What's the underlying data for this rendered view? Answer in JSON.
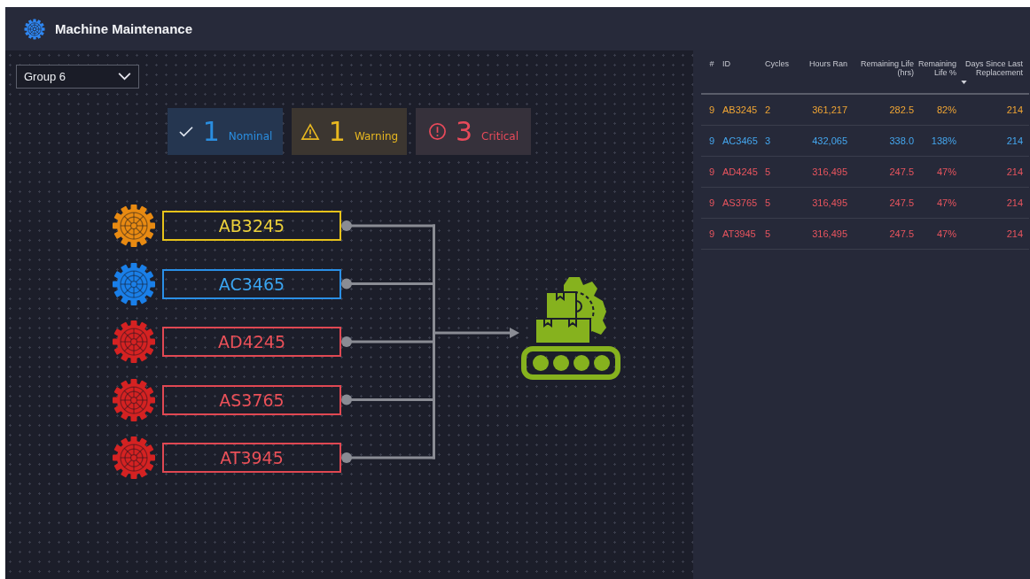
{
  "header": {
    "title": "Machine Maintenance"
  },
  "group_select": {
    "value": "Group 6"
  },
  "summary": [
    {
      "kind": "nominal",
      "count": "1",
      "label": "Nominal"
    },
    {
      "kind": "warning",
      "count": "1",
      "label": "Warning"
    },
    {
      "kind": "critical",
      "count": "3",
      "label": "Critical"
    }
  ],
  "machines": [
    {
      "id": "AB3245",
      "kind": "warning"
    },
    {
      "id": "AC3465",
      "kind": "nominal"
    },
    {
      "id": "AD4245",
      "kind": "critical"
    },
    {
      "id": "AS3765",
      "kind": "critical"
    },
    {
      "id": "AT3945",
      "kind": "critical"
    }
  ],
  "table": {
    "columns": [
      {
        "label": "#",
        "sorted": false
      },
      {
        "label": "ID",
        "sorted": false
      },
      {
        "label": "Cycles",
        "sorted": false
      },
      {
        "label": "Hours Ran",
        "sorted": false
      },
      {
        "label": "Remaining Life (hrs)",
        "sorted": false
      },
      {
        "label": "Remaining Life %",
        "sorted": true
      },
      {
        "label": "Days Since Last Replacement",
        "sorted": false
      }
    ],
    "rows": [
      {
        "kind": "warning",
        "cells": [
          "9",
          "AB3245",
          "2",
          "361,217",
          "282.5",
          "82%",
          "214"
        ]
      },
      {
        "kind": "nominal",
        "cells": [
          "9",
          "AC3465",
          "3",
          "432,065",
          "338.0",
          "138%",
          "214"
        ]
      },
      {
        "kind": "critical",
        "cells": [
          "9",
          "AD4245",
          "5",
          "316,495",
          "247.5",
          "47%",
          "214"
        ]
      },
      {
        "kind": "critical",
        "cells": [
          "9",
          "AS3765",
          "5",
          "316,495",
          "247.5",
          "47%",
          "214"
        ]
      },
      {
        "kind": "critical",
        "cells": [
          "9",
          "AT3945",
          "5",
          "316,495",
          "247.5",
          "47%",
          "214"
        ]
      }
    ]
  }
}
